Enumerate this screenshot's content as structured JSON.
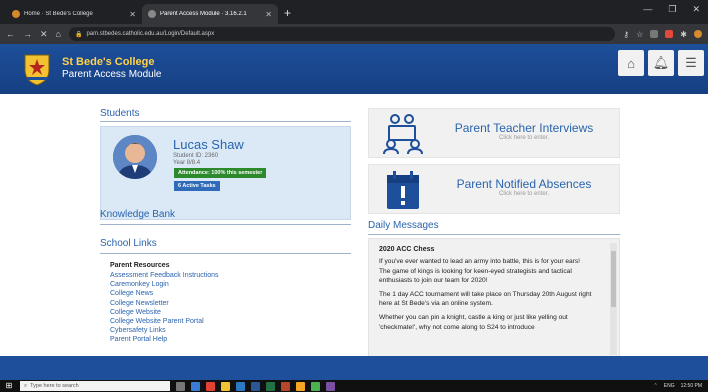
{
  "browser": {
    "tabs": [
      {
        "label": "Home · St Bede's College",
        "active": false
      },
      {
        "label": "Parent Access Module · 3.16.2.1",
        "active": true
      }
    ],
    "url": "pam.stbedes.catholic.edu.au/Login/Default.aspx",
    "window_controls": [
      "—",
      "❐",
      "✕"
    ]
  },
  "site": {
    "title": "St Bede's College",
    "subtitle": "Parent Access Module",
    "header_buttons": [
      "home-icon",
      "bell-icon",
      "menu-icon"
    ]
  },
  "students": {
    "heading": "Students",
    "name": "Lucas Shaw",
    "student_id": "Student ID: 2360",
    "year": "Year 8/8.4",
    "attendance_badge": "Attendance: 100% this semester",
    "tasks_badge": "6 Active Tasks"
  },
  "knowledge_bank": {
    "heading": "Knowledge Bank"
  },
  "school_links": {
    "heading": "School Links",
    "group_title": "Parent Resources",
    "links": [
      "Assessment Feedback Instructions",
      "Caremonkey Login",
      "College News",
      "College Newsletter",
      "College Website",
      "College Website Parent Portal",
      "Cybersafety Links",
      "Parent Portal Help"
    ]
  },
  "tiles": [
    {
      "title": "Parent Teacher Interviews",
      "subtitle": "Click here to enter.",
      "icon": "meeting-icon"
    },
    {
      "title": "Parent Notified Absences",
      "subtitle": "Click here to enter.",
      "icon": "calendar-alert-icon"
    }
  ],
  "daily_messages": {
    "heading": "Daily Messages",
    "title": "2020 ACC Chess",
    "paragraphs": [
      "If you've ever wanted to lead an army into battle, this is for your ears!\nThe game of kings is looking for keen-eyed strategists and tactical enthusiasts to join our team for 2020!",
      "The 1 day ACC tournament will take place on Thursday 20th August right here at St Bede's via an online system.",
      "Whether you can pin a knight, castle a king or just like yelling out 'checkmate!', why not come along to S24 to introduce"
    ]
  },
  "taskbar": {
    "search_placeholder": "Type here to search",
    "tray_time": "12:50 PM",
    "tray_lang": "ENG"
  },
  "colors": {
    "brand_blue": "#1d4f9a",
    "link_blue": "#2a64ad",
    "title_yellow": "#ffd24a",
    "attendance_green": "#2c8a2c"
  }
}
